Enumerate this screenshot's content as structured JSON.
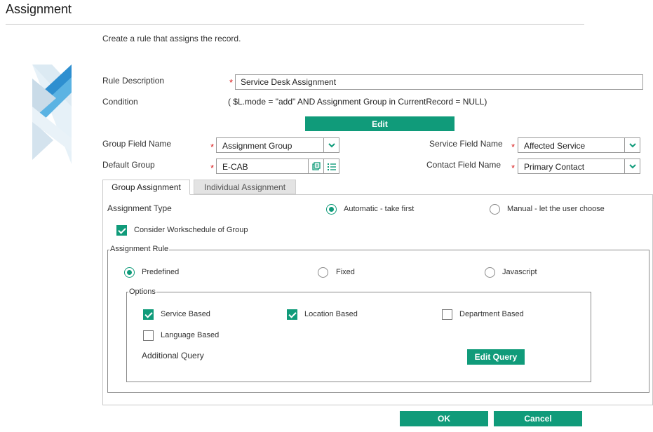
{
  "page": {
    "title": "Assignment",
    "subtitle": "Create a rule that assigns the record."
  },
  "form": {
    "rule_description": {
      "label": "Rule Description",
      "value": "Service Desk Assignment"
    },
    "condition": {
      "label": "Condition",
      "value": "( $L.mode = \"add\" AND Assignment Group in CurrentRecord = NULL)"
    },
    "edit_label": "Edit",
    "group_field_name": {
      "label": "Group Field Name",
      "value": "Assignment Group"
    },
    "default_group": {
      "label": "Default Group",
      "value": "E-CAB"
    },
    "service_field_name": {
      "label": "Service Field Name",
      "value": "Affected Service"
    },
    "contact_field_name": {
      "label": "Contact Field Name",
      "value": "Primary Contact"
    },
    "required_mark": "*"
  },
  "tabs": [
    {
      "label": "Group Assignment",
      "active": true
    },
    {
      "label": "Individual Assignment",
      "active": false
    }
  ],
  "group_assignment": {
    "assignment_type": {
      "label": "Assignment Type",
      "options": [
        {
          "label": "Automatic - take first",
          "selected": true
        },
        {
          "label": "Manual - let the user choose",
          "selected": false
        }
      ]
    },
    "consider_workschedule": {
      "label": "Consider Workschedule of Group",
      "checked": true
    },
    "assignment_rule": {
      "legend": "Assignment Rule",
      "options": [
        {
          "label": "Predefined",
          "selected": true
        },
        {
          "label": "Fixed",
          "selected": false
        },
        {
          "label": "Javascript",
          "selected": false
        }
      ]
    },
    "options": {
      "legend": "Options",
      "items": [
        {
          "label": "Service Based",
          "checked": true
        },
        {
          "label": "Location Based",
          "checked": true
        },
        {
          "label": "Department Based",
          "checked": false
        },
        {
          "label": "Language Based",
          "checked": false
        }
      ],
      "additional_query_label": "Additional Query",
      "edit_query_label": "Edit Query"
    }
  },
  "footer": {
    "ok_label": "OK",
    "cancel_label": "Cancel"
  },
  "colors": {
    "accent": "#109B7A",
    "required": "#D81B1B",
    "logo_blue": "#5BB3E3"
  },
  "icons": {
    "chevron": "chevron-down-icon",
    "lookup": "lookup-form-icon",
    "list": "list-icon",
    "logo": "brand-logo-icon"
  }
}
